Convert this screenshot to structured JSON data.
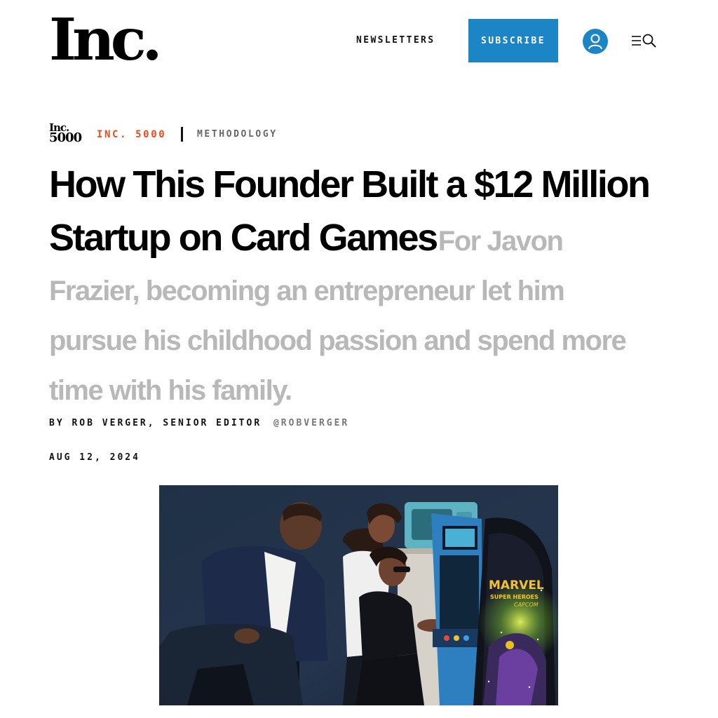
{
  "header": {
    "logo": "Inc.",
    "newsletters_label": "NEWSLETTERS",
    "subscribe_label": "SUBSCRIBE",
    "icons": {
      "account": "user-icon",
      "menu": "menu-icon",
      "search": "search-icon"
    },
    "colors": {
      "accent": "#1c85c5"
    }
  },
  "category": {
    "badge_line1": "Inc.",
    "badge_line2": "5000",
    "primary": "INC. 5000",
    "primary_color": "#ee4a1d",
    "secondary": "METHODOLOGY"
  },
  "article": {
    "headline": "How This Founder Built a $12 Million Startup on Card Games",
    "dek": "For Javon Frazier, becoming an entrepreneur let him pursue his childhood passion and spend more time with his family.",
    "byline": "BY ROB VERGER, SENIOR EDITOR",
    "handle": "@ROBVERGER",
    "date": "AUG 12, 2024",
    "hero": {
      "arcade_marquee_line1": "MARVEL",
      "arcade_marquee_line2": "SUPER HEROES",
      "arcade_marquee_line3": "CAPCOM"
    }
  }
}
